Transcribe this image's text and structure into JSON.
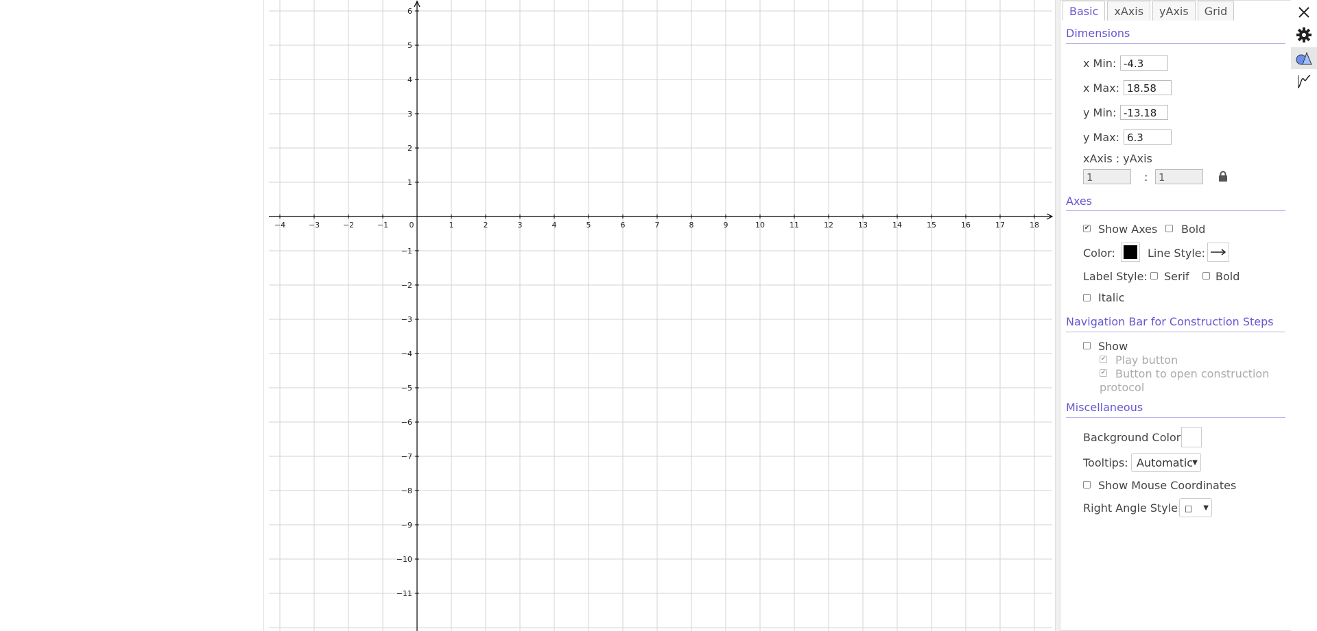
{
  "graph": {
    "x_ticks": [
      "−4",
      "−3",
      "−2",
      "−1",
      "0",
      "1",
      "2",
      "3",
      "4",
      "5",
      "6",
      "7",
      "8",
      "9",
      "10",
      "11",
      "12",
      "13",
      "14",
      "15",
      "16",
      "17",
      "18"
    ],
    "y_ticks_pos": [
      "6",
      "5",
      "4",
      "3",
      "2",
      "1"
    ],
    "y_ticks_neg": [
      "−1",
      "−2",
      "−3",
      "−4",
      "−5",
      "−6",
      "−7",
      "−8",
      "−9",
      "−10",
      "−11"
    ]
  },
  "tabs": [
    "Basic",
    "xAxis",
    "yAxis",
    "Grid"
  ],
  "dimensions": {
    "title": "Dimensions",
    "x_min_label": "x Min:",
    "x_min": "-4.3",
    "x_max_label": "x Max:",
    "x_max": "18.58",
    "y_min_label": "y Min:",
    "y_min": "-13.18",
    "y_max_label": "y Max:",
    "y_max": "6.3",
    "ratio_label": "xAxis : yAxis",
    "ratio_x": "1",
    "ratio_sep": ":",
    "ratio_y": "1"
  },
  "axes": {
    "title": "Axes",
    "show_axes": "Show Axes",
    "bold": "Bold",
    "color_label": "Color:",
    "line_style_label": "Line Style:",
    "label_style_label": "Label Style:",
    "serif": "Serif",
    "label_bold": "Bold",
    "italic": "Italic",
    "axis_color": "#000000"
  },
  "navbar": {
    "title": "Navigation Bar for Construction Steps",
    "show": "Show",
    "play_button": "Play button",
    "open_protocol_1": "Button to open construction",
    "open_protocol_2": "protocol"
  },
  "misc": {
    "title": "Miscellaneous",
    "bg_color_label": "Background Color:",
    "tooltips_label": "Tooltips:",
    "tooltips_value": "Automatic",
    "mouse_coords": "Show Mouse Coordinates",
    "right_angle_label": "Right Angle Style:",
    "right_angle_value": "□"
  },
  "icons": [
    "close-icon",
    "gear-icon",
    "graphics-view-icon",
    "algebra-graph-icon"
  ],
  "colors": {
    "accent": "#6557d2",
    "grid": "#d0d0d0",
    "axis": "#000000"
  }
}
